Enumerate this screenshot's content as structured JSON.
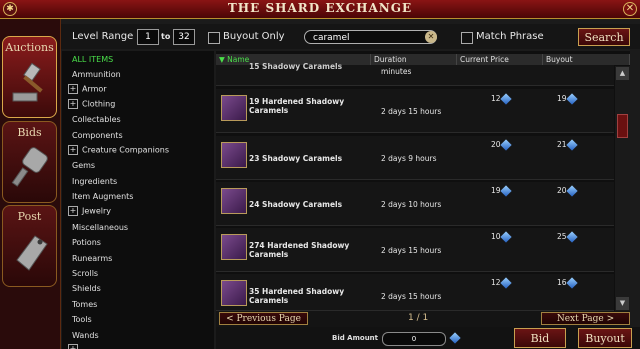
{
  "window": {
    "title": "THE SHARD EXCHANGE"
  },
  "side_tabs": [
    {
      "label": "Auctions",
      "icon": "gavel-icon"
    },
    {
      "label": "Bids",
      "icon": "bid-paddle-icon"
    },
    {
      "label": "Post",
      "icon": "price-tag-icon"
    }
  ],
  "filters": {
    "level_range_label": "Level Range",
    "level_min": "1",
    "to_label": "to",
    "level_max": "32",
    "buyout_only_label": "Buyout Only",
    "search_value": "caramel",
    "match_phrase_label": "Match Phrase",
    "search_button": "Search"
  },
  "categories": [
    {
      "label": "ALL ITEMS",
      "selected": true,
      "expandable": false
    },
    {
      "label": "Ammunition",
      "expandable": false
    },
    {
      "label": "Armor",
      "expandable": true
    },
    {
      "label": "Clothing",
      "expandable": true
    },
    {
      "label": "Collectables",
      "expandable": false
    },
    {
      "label": "Components",
      "expandable": false
    },
    {
      "label": "Creature Companions",
      "expandable": true
    },
    {
      "label": "Gems",
      "expandable": false
    },
    {
      "label": "Ingredients",
      "expandable": false
    },
    {
      "label": "Item Augments",
      "expandable": false
    },
    {
      "label": "Jewelry",
      "expandable": true
    },
    {
      "label": "Miscellaneous",
      "expandable": false
    },
    {
      "label": "Potions",
      "expandable": false
    },
    {
      "label": "Runearms",
      "expandable": false
    },
    {
      "label": "Scrolls",
      "expandable": false
    },
    {
      "label": "Shields",
      "expandable": false
    },
    {
      "label": "Tomes",
      "expandable": false
    },
    {
      "label": "Tools",
      "expandable": false
    },
    {
      "label": "Wands",
      "expandable": false
    }
  ],
  "columns": {
    "name": "Name",
    "duration": "Duration",
    "current_price": "Current Price",
    "buyout": "Buyout"
  },
  "partial_row": {
    "name": "15 Shadowy Caramels",
    "duration": "minutes"
  },
  "rows": [
    {
      "name": "19 Hardened Shadowy Caramels",
      "duration": "2 days 15 hours",
      "price": "12",
      "buyout": "19"
    },
    {
      "name": "23 Shadowy Caramels",
      "duration": "2 days 9 hours",
      "price": "20",
      "buyout": "21"
    },
    {
      "name": "24 Shadowy Caramels",
      "duration": "2 days 10 hours",
      "price": "19",
      "buyout": "20"
    },
    {
      "name": "274 Hardened Shadowy Caramels",
      "duration": "2 days 15 hours",
      "price": "10",
      "buyout": "25"
    },
    {
      "name": "35 Hardened Shadowy Caramels",
      "duration": "2 days 15 hours",
      "price": "12",
      "buyout": "16"
    }
  ],
  "pager": {
    "prev": "< Previous Page",
    "page": "1 / 1",
    "next": "Next Page >"
  },
  "bid": {
    "label": "Bid Amount",
    "value": "0",
    "bid_button": "Bid",
    "buyout_button": "Buyout"
  },
  "colors": {
    "accent_red": "#6a1414",
    "gold_border": "#c8a050",
    "selected_green": "#4adf4a"
  }
}
